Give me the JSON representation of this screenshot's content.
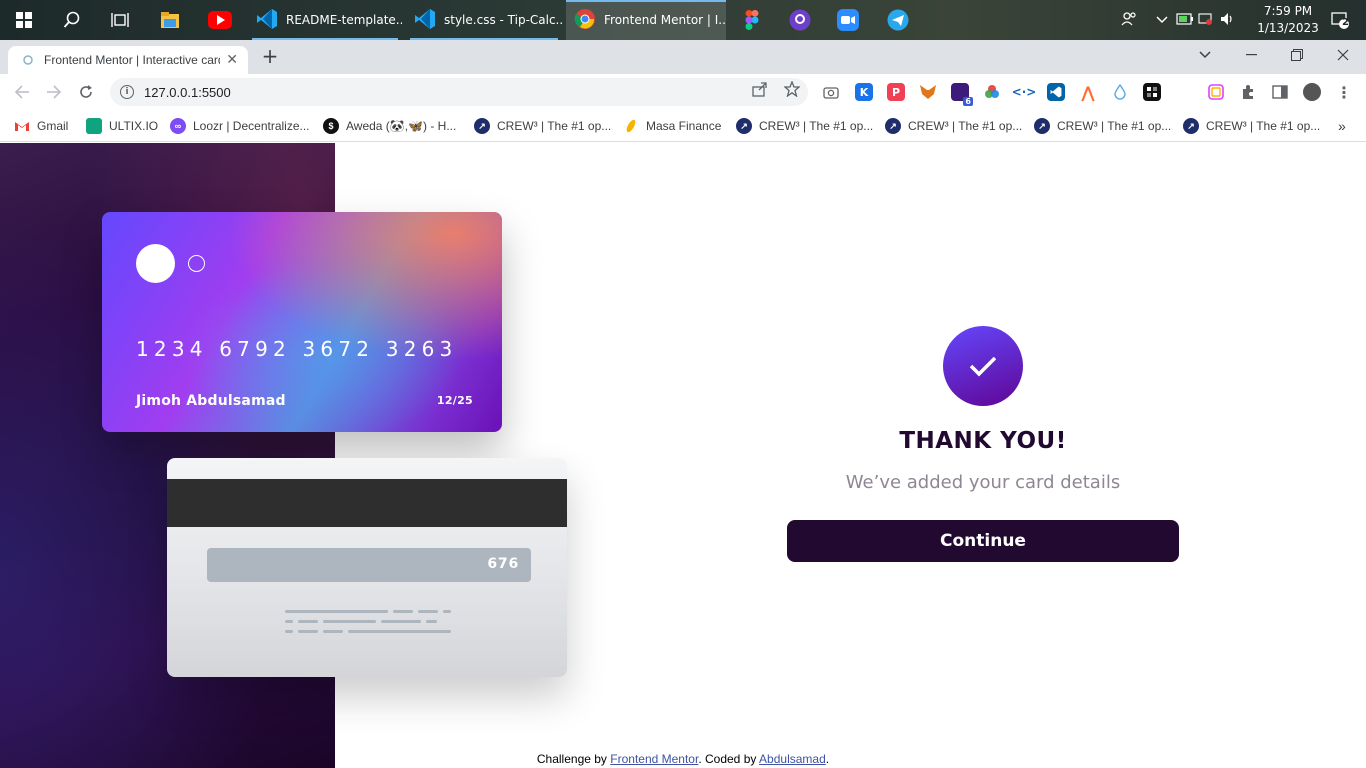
{
  "taskbar": {
    "apps": [
      {
        "label": "README-template....",
        "icon": "vscode-icon"
      },
      {
        "label": "style.css - Tip-Calc...",
        "icon": "vscode-icon"
      },
      {
        "label": "Frontend Mentor | I...",
        "icon": "chrome-icon"
      }
    ],
    "clock": {
      "time": "7:59 PM",
      "date": "1/13/2023"
    },
    "notification_count": "2"
  },
  "browser": {
    "tab_title": "Frontend Mentor | Interactive card",
    "url": "127.0.0.1:5500",
    "bookmarks": [
      {
        "label": "Gmail",
        "color": "#ea4335"
      },
      {
        "label": "ULTIX.IO",
        "color": "#10a37f"
      },
      {
        "label": "Loozr | Decentralize...",
        "color": "#7b4df3"
      },
      {
        "label": "Aweda (🐼,🦋) - H...",
        "color": "#111111"
      },
      {
        "label": "CREW³ | The #1 op...",
        "color": "#1f2d6b"
      },
      {
        "label": "Masa Finance",
        "color": "#f4b400"
      },
      {
        "label": "CREW³ | The #1 op...",
        "color": "#1f2d6b"
      },
      {
        "label": "CREW³ | The #1 op...",
        "color": "#1f2d6b"
      },
      {
        "label": "CREW³ | The #1 op...",
        "color": "#1f2d6b"
      },
      {
        "label": "CREW³ | The #1 op...",
        "color": "#1f2d6b"
      }
    ],
    "extension_badge": "6"
  },
  "card": {
    "number": "1234 6792 3672 3263",
    "name": "Jimoh Abdulsamad",
    "expiry": "12/25",
    "cvc": "676"
  },
  "success": {
    "heading": "THANK YOU!",
    "message": "We’ve added your card details",
    "button": "Continue"
  },
  "footer": {
    "prefix": "Challenge by ",
    "link1": "Frontend Mentor",
    "middle": ". Coded by ",
    "link2": "Abdulsamad",
    "suffix": "."
  },
  "colors": {
    "accent_dark": "#21092f",
    "muted_text": "#8f8694",
    "link": "#3e52a3"
  }
}
